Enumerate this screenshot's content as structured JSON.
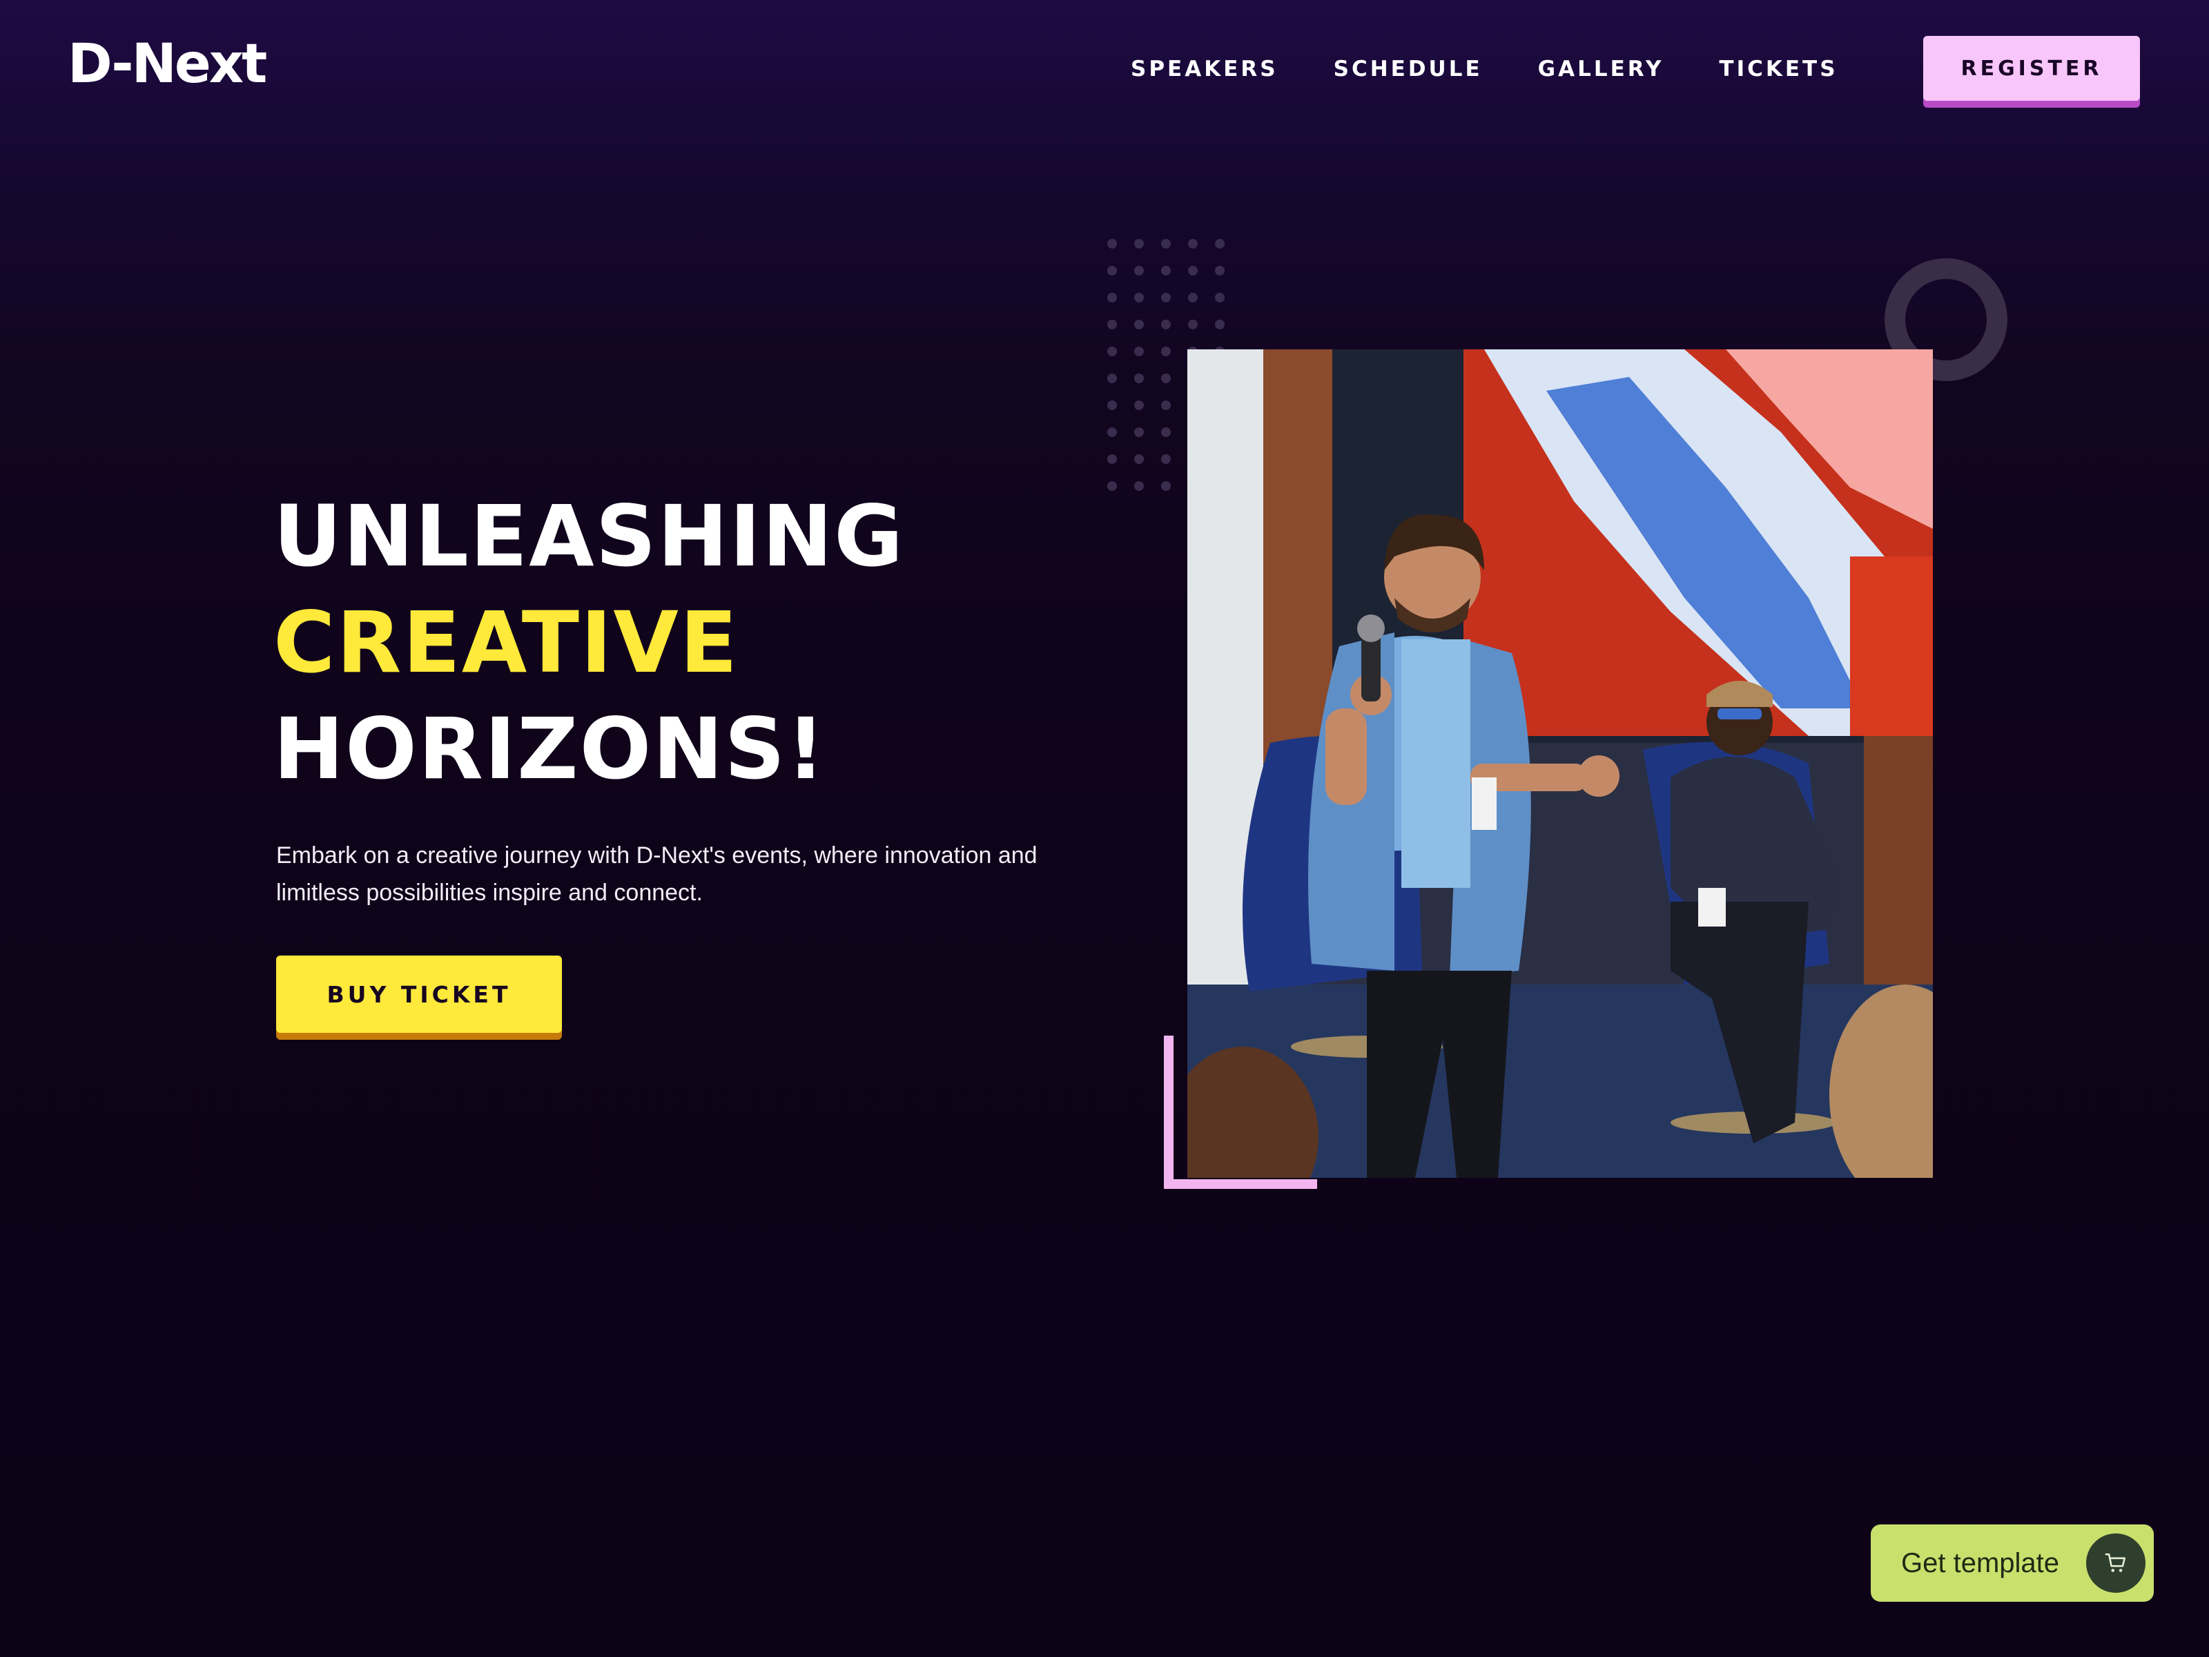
{
  "header": {
    "logo": "D-Next",
    "nav": [
      "SPEAKERS",
      "SCHEDULE",
      "GALLERY",
      "TICKETS"
    ],
    "register_label": "REGISTER"
  },
  "hero": {
    "title_line1": "UNLEASHING",
    "title_line2": "CREATIVE",
    "title_line3": "HORIZONS!",
    "description": "Embark on a creative journey with D-Next's events, where innovation and limitless possibilities inspire and connect.",
    "cta_label": "BUY TICKET"
  },
  "floating": {
    "get_template_label": "Get template"
  },
  "colors": {
    "background": "#0f0319",
    "accent_yellow": "#ffe93a",
    "accent_pink": "#f8c6fa",
    "template_button": "#c9e06d"
  },
  "icons": [
    "cart-icon"
  ]
}
